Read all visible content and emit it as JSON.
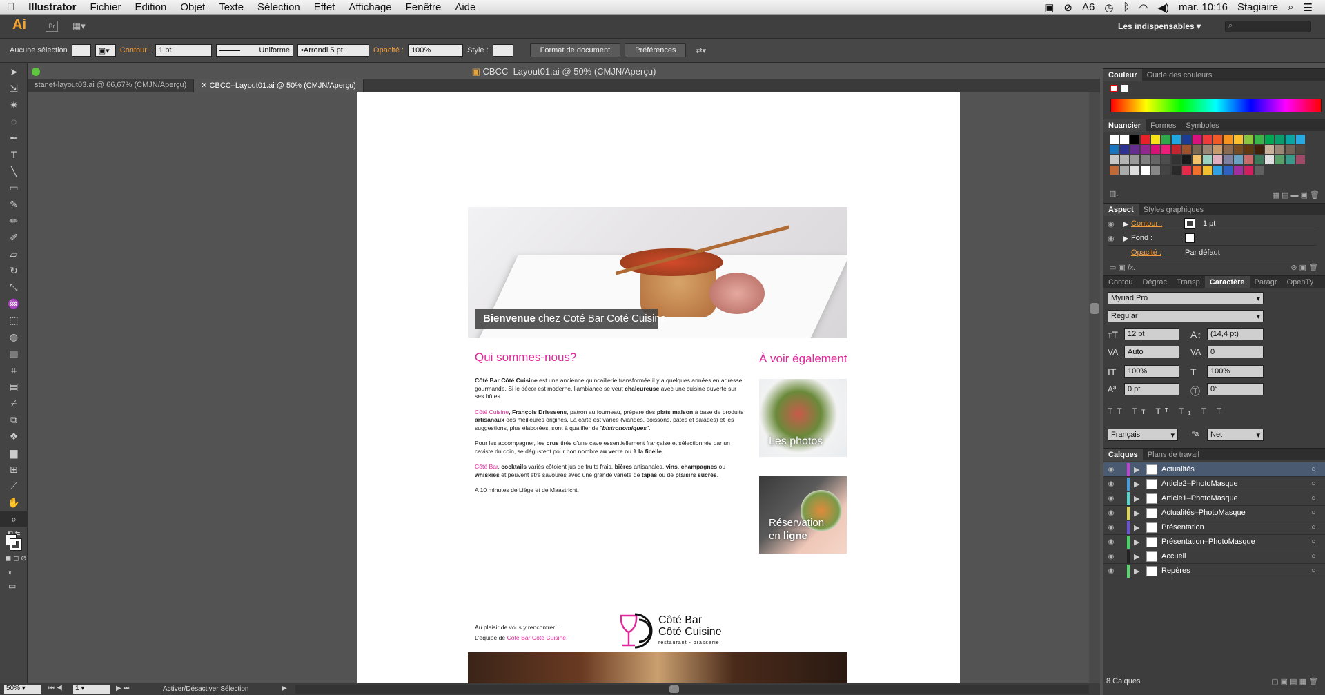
{
  "menubar": {
    "apple": "",
    "app": "Illustrator",
    "items": [
      "Fichier",
      "Edition",
      "Objet",
      "Texte",
      "Sélection",
      "Effet",
      "Affichage",
      "Fenêtre",
      "Aide"
    ],
    "adobe_badge": "6",
    "clock": "mar. 10:16",
    "user": "Stagiaire"
  },
  "appbar": {
    "logo": "Ai",
    "bridge": "Br",
    "workspace": "Les indispensables"
  },
  "control": {
    "selection": "Aucune sélection",
    "contour_label": "Contour :",
    "contour_value": "1 pt",
    "stroke_style": "Uniforme",
    "brush": "Arrondi 5 pt",
    "opacity_label": "Opacité :",
    "opacity_value": "100%",
    "style_label": "Style :",
    "doc_format_button": "Format de document",
    "prefs_button": "Préférences"
  },
  "document": {
    "title": "CBCC–Layout01.ai @ 50% (CMJN/Aperçu)",
    "tabs": [
      {
        "label": "stanet-layout03.ai @ 66,67% (CMJN/Aperçu)",
        "active": false
      },
      {
        "label": "CBCC–Layout01.ai @ 50% (CMJN/Aperçu)",
        "active": true
      }
    ]
  },
  "artboard": {
    "banner_caption_a": "Bienvenue",
    "banner_caption_b": " chez Coté Bar Coté Cuisine",
    "heading_left": "Qui sommes-nous?",
    "heading_right": "À voir également",
    "p1_a": "Côté Bar Côté Cuisine",
    "p1_b": " est une ancienne quincaillerie transformée il y a quelques années en adresse gourmande. Si le décor est moderne, l'ambiance se veut ",
    "p1_c": "chaleureuse",
    "p1_d": " avec une cuisine ouverte sur ses hôtes.",
    "p2_a": "Côté Cuisine",
    "p2_b": ", François Driessens",
    "p2_c": ", patron au fourneau, prépare des ",
    "p2_d": "plats maison",
    "p2_e": " à base de produits ",
    "p2_f": "artisanaux",
    "p2_g": " des meilleures origines. La carte est variée (viandes, poissons, pâtes et salades) et les suggestions, plus élaborées, sont à qualifier de \"",
    "p2_h": "bistronomiques",
    "p2_i": "\".",
    "p3_a": "Pour les accompagner, les ",
    "p3_b": "crus",
    "p3_c": "  tirés d'une cave essentiellement française et sélectionnés par un caviste du coin, se dégustent pour bon nombre ",
    "p3_d": "au verre ou à la ficelle",
    "p3_e": ".",
    "p4_a": "Côté Bar",
    "p4_b": ", ",
    "p4_c": "cocktails",
    "p4_d": " variés côtoient jus de fruits frais, ",
    "p4_e": "bières",
    "p4_f": " artisanales, ",
    "p4_g": "vins",
    "p4_h": ", ",
    "p4_i": "champagnes",
    "p4_j": " ou ",
    "p4_k": "whiskies",
    "p4_l": " et peuvent être savourés avec une grande variété de ",
    "p4_m": "tapas",
    "p4_n": " ou de ",
    "p4_o": "plaisirs sucrés",
    "p4_p": ".",
    "p5": "A 10 minutes de Liège et de Maastricht.",
    "sign1": "Au plaisir de vous y rencontrer...",
    "sign2_a": "L'équipe de ",
    "sign2_b": "Côté Bar Côté Cuisine",
    "sign2_c": ".",
    "logo_line1": "Côté Bar",
    "logo_line2": "Côté Cuisine",
    "logo_sub": "restaurant - brasserie",
    "card1": "Les photos",
    "card2_a": "Réservation",
    "card2_b": "en ",
    "card2_c": "ligne"
  },
  "status": {
    "zoom": "50%",
    "artboard": "1",
    "info": "Activer/Désactiver Sélection"
  },
  "panels": {
    "color_tabs": [
      "Couleur",
      "Guide des couleurs"
    ],
    "swatch_tabs": [
      "Nuancier",
      "Formes",
      "Symboles"
    ],
    "aspect_tabs": [
      "Aspect",
      "Styles graphiques"
    ],
    "aspect_rows": [
      {
        "label": "Contour :",
        "value": "1 pt"
      },
      {
        "label": "Fond :",
        "value": ""
      },
      {
        "label": "Opacité :",
        "value": "Par défaut"
      }
    ],
    "fx": "fx.",
    "char_tabs": [
      "Contou",
      "Dégrac",
      "Transp",
      "Caractère",
      "Paragr",
      "OpenTy"
    ],
    "font": "Myriad Pro",
    "font_style": "Regular",
    "size": "12 pt",
    "leading": "(14,4 pt)",
    "kerning": "Auto",
    "tracking": "0",
    "vscale": "100%",
    "hscale": "100%",
    "baseline": "0 pt",
    "rotation": "0°",
    "language": "Français",
    "antialias": "Net",
    "layer_tabs": [
      "Calques",
      "Plans de travail"
    ],
    "layers": [
      {
        "name": "Actualités",
        "color": "#c63fd8"
      },
      {
        "name": "Article2–PhotoMasque",
        "color": "#3f9fe8"
      },
      {
        "name": "Article1–PhotoMasque",
        "color": "#4ed9d0"
      },
      {
        "name": "Actualités–PhotoMasque",
        "color": "#e0d84a"
      },
      {
        "name": "Présentation",
        "color": "#6a4fe0"
      },
      {
        "name": "Présentation–PhotoMasque",
        "color": "#3ed95c"
      },
      {
        "name": "Accueil",
        "color": "#222222"
      },
      {
        "name": "Repères",
        "color": "#53d96a"
      }
    ],
    "layer_count": "8 Calques"
  }
}
